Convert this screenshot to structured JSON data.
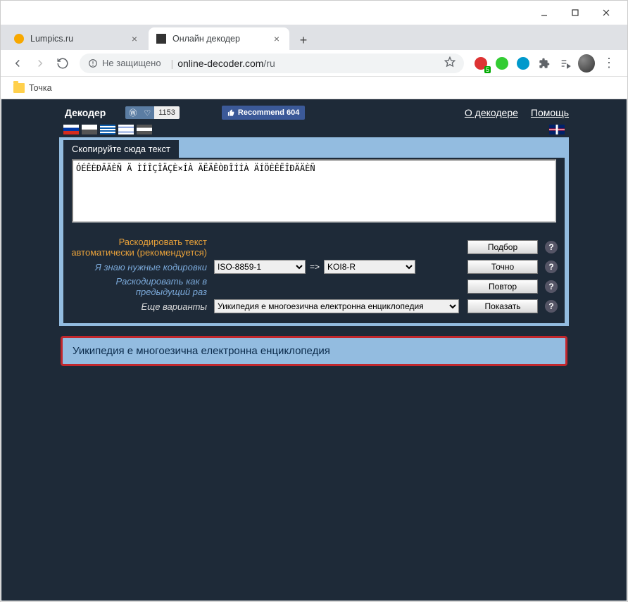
{
  "window": {
    "tabs": [
      {
        "title": "Lumpics.ru"
      },
      {
        "title": "Онлайн декодер"
      }
    ]
  },
  "addressbar": {
    "insecure_label": "Не защищено",
    "url_host": "online-decoder.com",
    "url_path": "/ru"
  },
  "bookmarks": {
    "item1": "Точка"
  },
  "ext_badge": "5",
  "page": {
    "brand": "Декодер",
    "vk_like": "1153",
    "fb_recommend": "Recommend 604",
    "link_about": "О декодере",
    "link_help": "Помощь",
    "section_copy": "Скопируйте сюда текст",
    "input_text": "ÓÉÊÈĐÄÄÈÑ Ä ÌÍÎÇÎÄÇÈ×ÍÀ ÄËÄÊÒĐÎÍÍÀ ÄÍÖÈÊËÎĐÄÄÈÑ",
    "row_auto": "Раскодировать текст автоматически (рекомендуется)",
    "row_known": "Я знаю нужные кодировки",
    "enc_from": "ISO-8859-1",
    "enc_to": "KOI8-R",
    "row_prev": "Раскодировать как в предыдущий раз",
    "row_more": "Еще варианты",
    "variant_selected": "Уикипедия е многоезична електронна енциклопедия",
    "btn_auto": "Подбор",
    "btn_exact": "Точно",
    "btn_repeat": "Повтор",
    "btn_show": "Показать",
    "result": "Уикипедия е многоезична електронна енциклопедия"
  }
}
